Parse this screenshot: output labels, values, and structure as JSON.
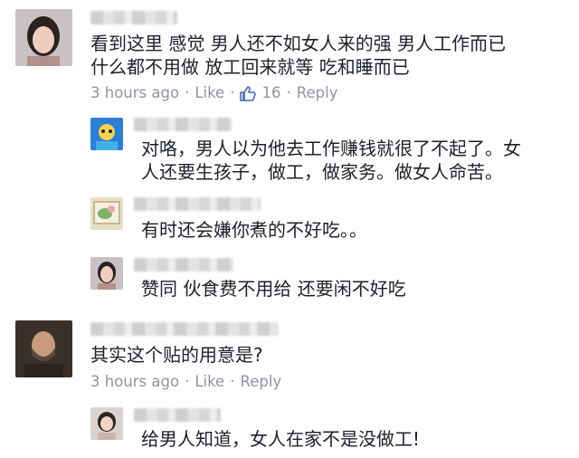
{
  "comments": [
    {
      "text_lines": [
        "看到这里 感觉 男人还不如女人来的强 男人工作而已",
        "什么都不用做 放工回来就等 吃和睡而已"
      ],
      "time": "3 hours ago",
      "like_label": "Like",
      "like_count": "16",
      "reply_label": "Reply",
      "replies": [
        {
          "text_lines": [
            "对咯，男人以为他去工作赚钱就很了不起了。女",
            "人还要生孩子，做工，做家务。做女人命苦。"
          ]
        },
        {
          "text_lines": [
            "有时还会嫌你煮的不好吃。。"
          ]
        },
        {
          "text_lines": [
            "赞同 伙食费不用给 还要闲不好吃"
          ]
        }
      ]
    },
    {
      "text_lines": [
        "其实这个贴的用意是?"
      ],
      "time": "3 hours ago",
      "like_label": "Like",
      "reply_label": "Reply",
      "replies": [
        {
          "text_lines": [
            "给男人知道，女人在家不是没做工!"
          ]
        }
      ]
    }
  ],
  "separator": "·",
  "colors": {
    "text": "#1d2129",
    "meta": "#90949c",
    "like_blue": "#4267b2"
  }
}
